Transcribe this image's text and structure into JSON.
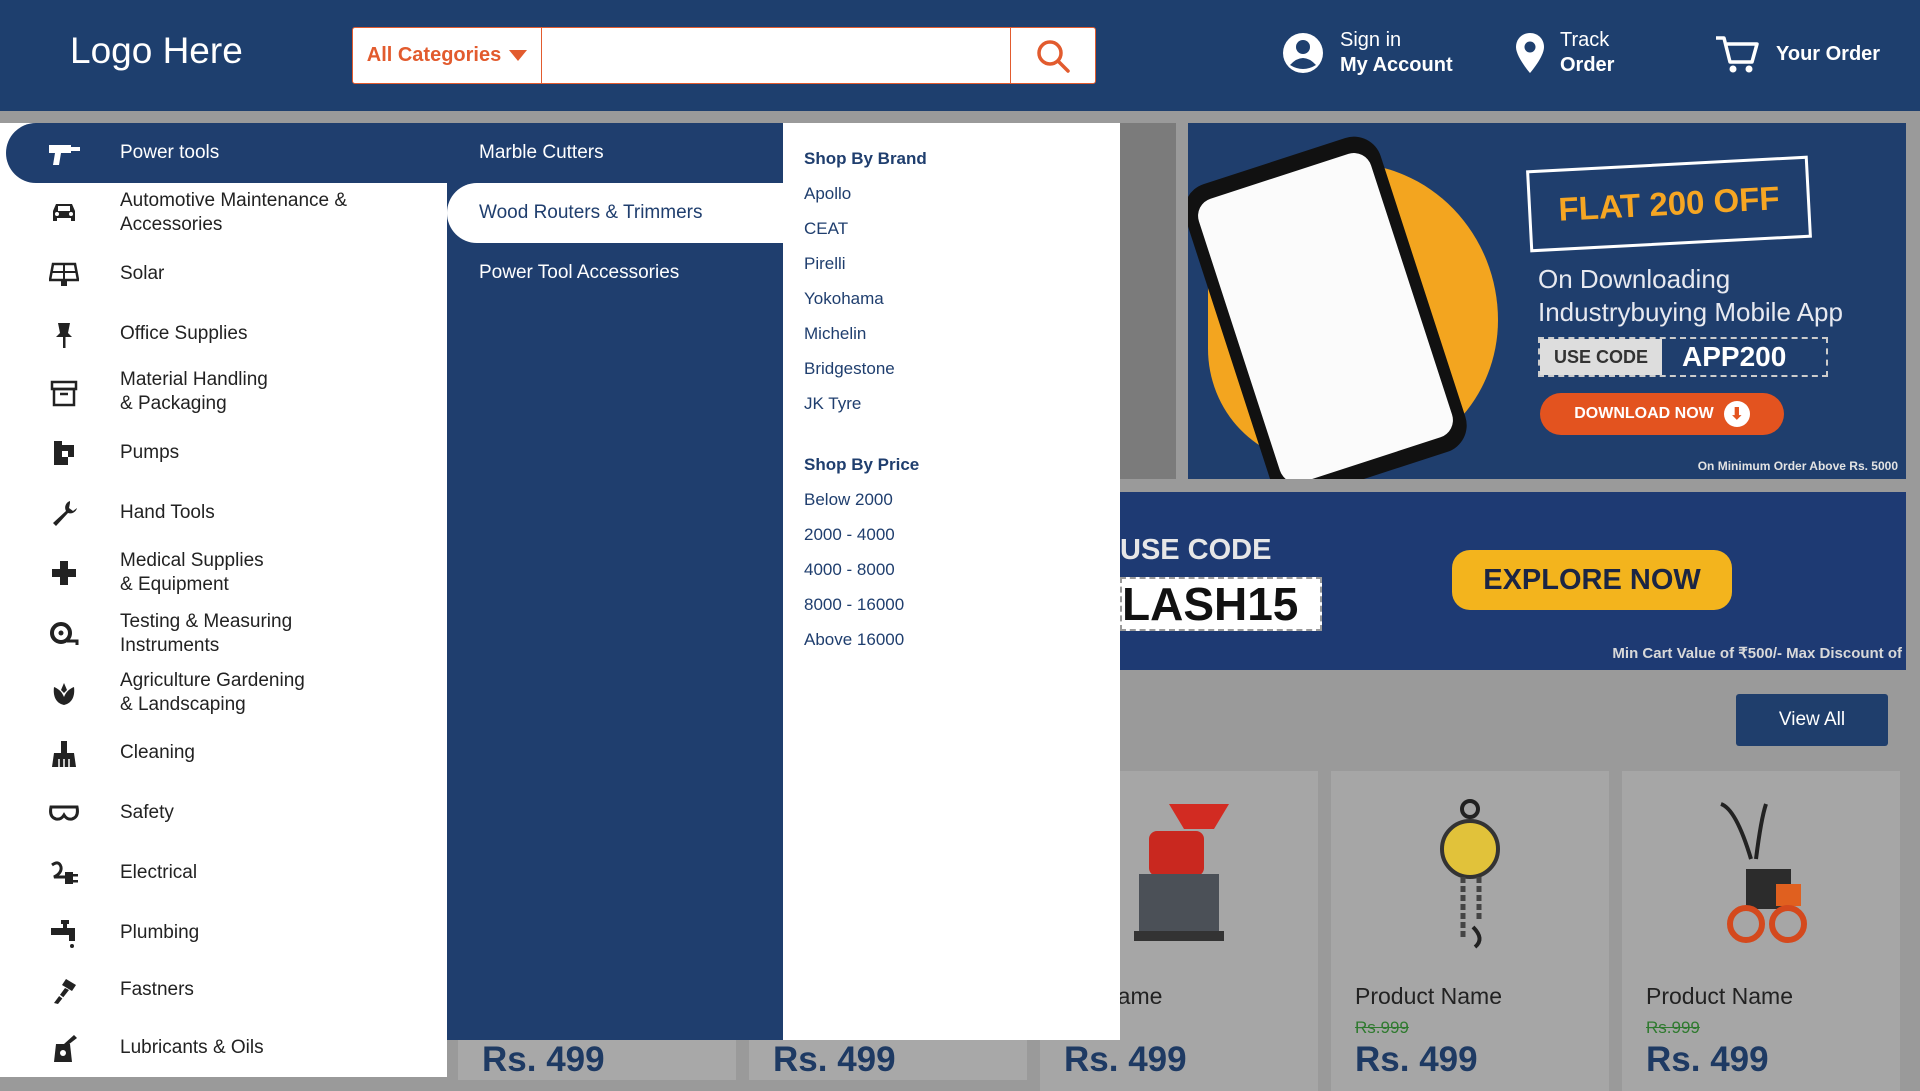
{
  "header": {
    "logo": "Logo Here",
    "category_label": "All Categories",
    "search_value": "",
    "search_placeholder": "",
    "sign_in": "Sign in",
    "my_account": "My Account",
    "track": "Track",
    "order": "Order",
    "your_order": "Your Order"
  },
  "colors": {
    "header_bg": "#1e3f6e",
    "accent": "#e25b2e",
    "menu_bg": "#1f3e6e"
  },
  "sidebar": {
    "items": [
      {
        "label": "Power tools",
        "icon": "drill-icon"
      },
      {
        "label": "Automotive Maintenance &\nAccessories",
        "icon": "car-icon"
      },
      {
        "label": "Solar",
        "icon": "solar-panel-icon"
      },
      {
        "label": "Office Supplies",
        "icon": "pushpin-icon"
      },
      {
        "label": "Material Handling\n& Packaging",
        "icon": "box-icon"
      },
      {
        "label": "Pumps",
        "icon": "pump-icon"
      },
      {
        "label": "Hand Tools",
        "icon": "wrench-icon"
      },
      {
        "label": "Medical Supplies\n& Equipment",
        "icon": "medical-cross-icon"
      },
      {
        "label": "Testing & Measuring\nInstruments",
        "icon": "measuring-tape-icon"
      },
      {
        "label": "Agriculture Gardening\n& Landscaping",
        "icon": "plant-icon"
      },
      {
        "label": "Cleaning",
        "icon": "brush-icon"
      },
      {
        "label": "Safety",
        "icon": "goggles-icon"
      },
      {
        "label": "Electrical",
        "icon": "plug-icon"
      },
      {
        "label": "Plumbing",
        "icon": "faucet-icon"
      },
      {
        "label": "Fastners",
        "icon": "bolt-icon"
      },
      {
        "label": "Lubricants & Oils",
        "icon": "oil-can-icon"
      }
    ]
  },
  "submenu": {
    "items": [
      "Marble Cutters",
      "Wood Routers & Trimmers",
      "Power Tool Accessories"
    ]
  },
  "filters": {
    "brand_heading": "Shop By Brand",
    "brands": [
      "Apollo",
      "CEAT",
      "Pirelli",
      "Yokohama",
      "Michelin",
      "Bridgestone",
      "JK Tyre"
    ],
    "price_heading": "Shop By Price",
    "prices": [
      "Below 2000",
      "2000 - 4000",
      "4000 - 8000",
      "8000 - 16000",
      "Above 16000"
    ]
  },
  "banner1": {
    "headline": "FLAT 200 OFF",
    "line1": "On Downloading",
    "line2": "Industrybuying Mobile App",
    "use_code": "USE CODE",
    "code": "APP200",
    "download": "DOWNLOAD NOW",
    "min_order": "On Minimum Order Above Rs. 5000"
  },
  "banner2": {
    "use_code": "USE CODE",
    "code": "LASH15",
    "explore": "EXPLORE NOW",
    "note": "Min Cart Value of ₹500/- Max Discount of"
  },
  "products": {
    "view_all": "View All",
    "items": [
      {
        "name": "uct Name",
        "mrp": "",
        "price": "Rs. 499"
      },
      {
        "name": "Product Name",
        "mrp": "Rs.999",
        "price": "Rs. 499"
      },
      {
        "name": "Product Name",
        "mrp": "Rs.999",
        "price": "Rs. 499"
      }
    ],
    "hidden_prices": [
      "Rs. 499",
      "Rs. 499"
    ]
  }
}
